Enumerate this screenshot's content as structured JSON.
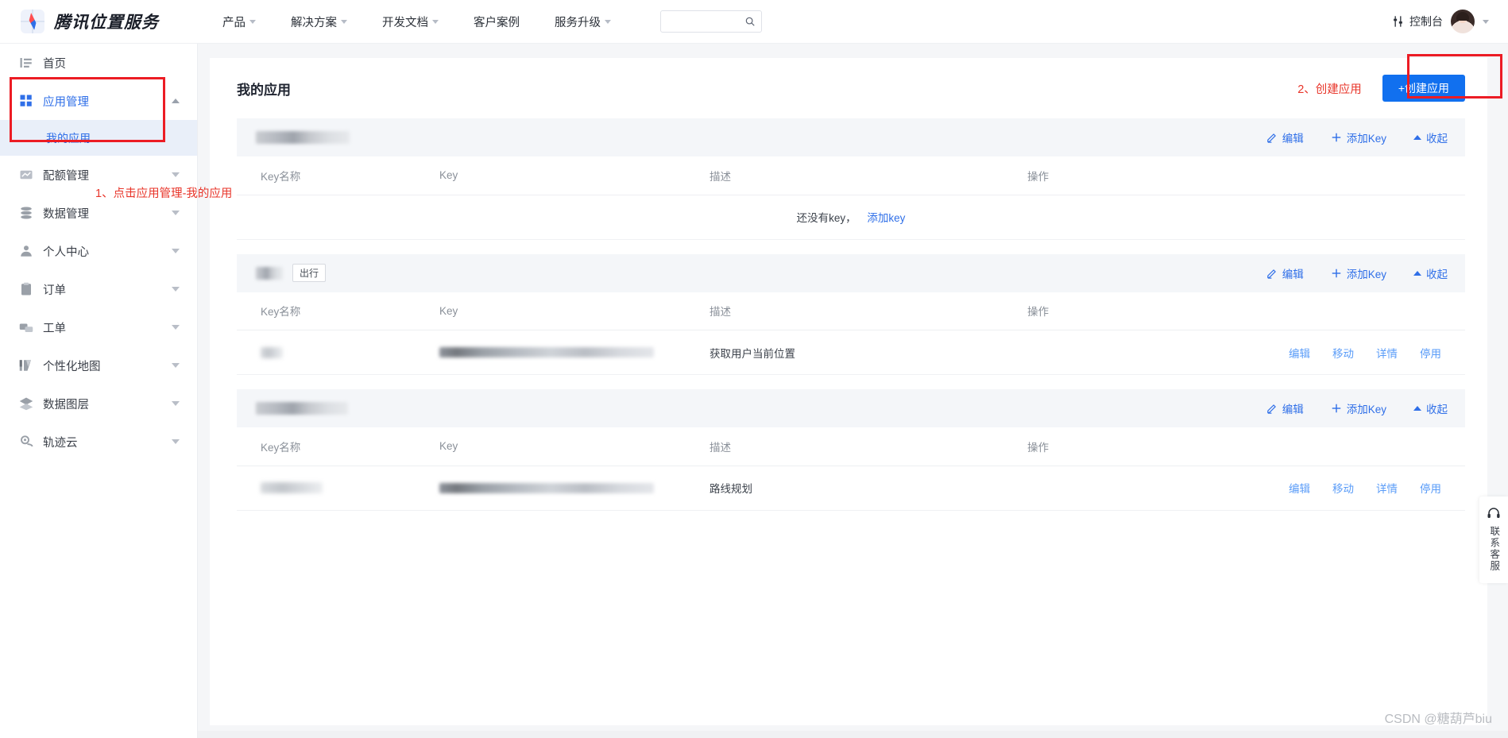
{
  "header": {
    "brand": "腾讯位置服务",
    "nav": [
      {
        "label": "产品",
        "has_caret": true
      },
      {
        "label": "解决方案",
        "has_caret": true
      },
      {
        "label": "开发文档",
        "has_caret": true
      },
      {
        "label": "客户案例",
        "has_caret": false
      },
      {
        "label": "服务升级",
        "has_caret": true
      }
    ],
    "search": {
      "value": "",
      "placeholder": "",
      "icon": "search-icon"
    },
    "console_label": "控制台",
    "console_icon": "sliders-icon",
    "avatar_icon": "user-avatar"
  },
  "sidebar": {
    "items": [
      {
        "label": "首页",
        "icon": "home-list-icon",
        "caret": "none",
        "active": false
      },
      {
        "label": "应用管理",
        "icon": "grid-icon",
        "caret": "up",
        "active": true
      },
      {
        "label": "配额管理",
        "icon": "chart-icon",
        "caret": "down",
        "active": false
      },
      {
        "label": "数据管理",
        "icon": "database-icon",
        "caret": "down",
        "active": false
      },
      {
        "label": "个人中心",
        "icon": "person-icon",
        "caret": "down",
        "active": false
      },
      {
        "label": "订单",
        "icon": "clipboard-icon",
        "caret": "down",
        "active": false
      },
      {
        "label": "工单",
        "icon": "ticket-icon",
        "caret": "down",
        "active": false
      },
      {
        "label": "个性化地图",
        "icon": "map-style-icon",
        "caret": "down",
        "active": false
      },
      {
        "label": "数据图层",
        "icon": "layers-icon",
        "caret": "down",
        "active": false
      },
      {
        "label": "轨迹云",
        "icon": "track-icon",
        "caret": "down",
        "active": false
      }
    ],
    "submenu_label": "我的应用"
  },
  "main": {
    "page_title": "我的应用",
    "create_annotation": "2、创建应用",
    "create_button": "+创建应用",
    "table_headers": {
      "name": "Key名称",
      "key": "Key",
      "desc": "描述",
      "ops": "操作"
    },
    "card_actions": {
      "edit": "编辑",
      "add_key": "添加Key",
      "collapse": "收起"
    },
    "row_actions": [
      "编辑",
      "移动",
      "详情",
      "停用"
    ],
    "empty_state": {
      "text": "还没有key，",
      "link": "添加key"
    },
    "apps": [
      {
        "name_redacted": true,
        "name_width": 118,
        "tag": null,
        "rows": []
      },
      {
        "name_redacted": true,
        "name_width": 34,
        "tag": "出行",
        "rows": [
          {
            "name_redacted": true,
            "name_width": 28,
            "key_redacted": true,
            "desc": "获取用户当前位置"
          }
        ]
      },
      {
        "name_redacted": true,
        "name_width": 116,
        "tag": null,
        "rows": [
          {
            "name_redacted": true,
            "name_width": 78,
            "key_redacted": true,
            "desc": "路线规划"
          }
        ]
      }
    ]
  },
  "annotations": {
    "sidebar_step": "1、点击应用管理-我的应用"
  },
  "support_widget": {
    "icon": "headset-icon",
    "label": "联系客服"
  },
  "watermark": "CSDN @糖葫芦biu",
  "colors": {
    "accent": "#2f6fe8",
    "button": "#1170ef",
    "annotation": "#e8352a",
    "card_header_bg": "#f4f6f9"
  }
}
